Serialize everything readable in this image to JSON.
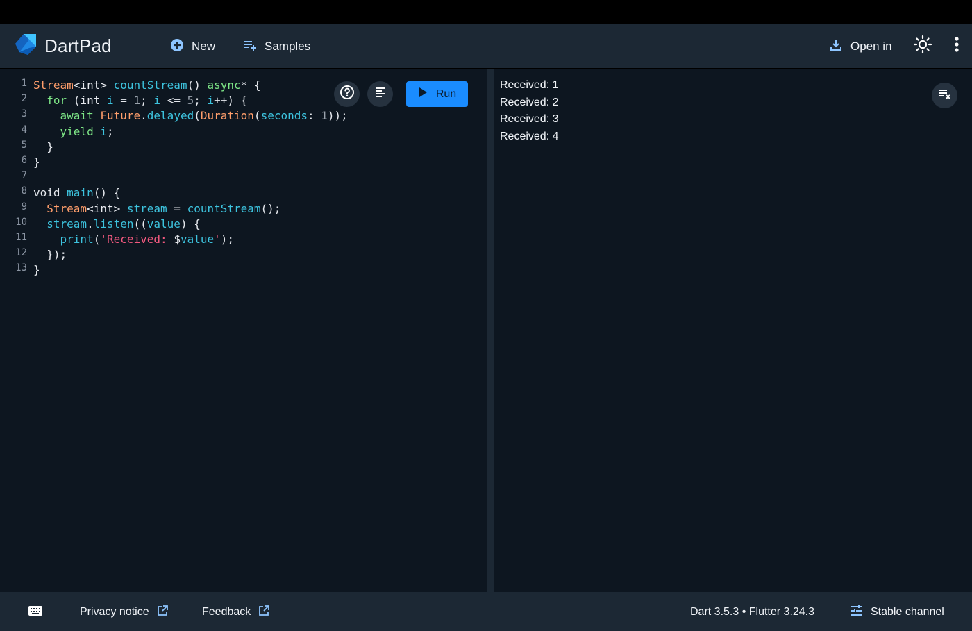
{
  "app": {
    "title": "DartPad",
    "new_label": "New",
    "samples_label": "Samples",
    "open_in_label": "Open in",
    "theme_icon": "sun-icon",
    "more_icon": "more-vert-icon"
  },
  "editor": {
    "run_label": "Run",
    "line_numbers": [
      "1",
      "2",
      "3",
      "4",
      "5",
      "6",
      "7",
      "8",
      "9",
      "10",
      "11",
      "12",
      "13"
    ],
    "code_lines": [
      "Stream<int> countStream() async* {",
      "  for (int i = 1; i <= 5; i++) {",
      "    await Future.delayed(Duration(seconds: 1));",
      "    yield i;",
      "  }",
      "}",
      "",
      "void main() {",
      "  Stream<int> stream = countStream();",
      "  stream.listen((value) {",
      "    print('Received: $value');",
      "  });",
      "}"
    ]
  },
  "output": {
    "lines": [
      "Received: 1",
      "Received: 2",
      "Received: 3",
      "Received: 4"
    ]
  },
  "footer": {
    "privacy_label": "Privacy notice",
    "feedback_label": "Feedback",
    "versions": "Dart 3.5.3 • Flutter 3.24.3",
    "channel_label": "Stable channel"
  },
  "colors": {
    "appbar": "#1c2834",
    "editor_bg": "#0d1620",
    "run_button": "#1a8cff",
    "keyword": "#7ee787",
    "type": "#ff9e6b",
    "identifier": "#3dc3de",
    "string": "#f2597f"
  }
}
